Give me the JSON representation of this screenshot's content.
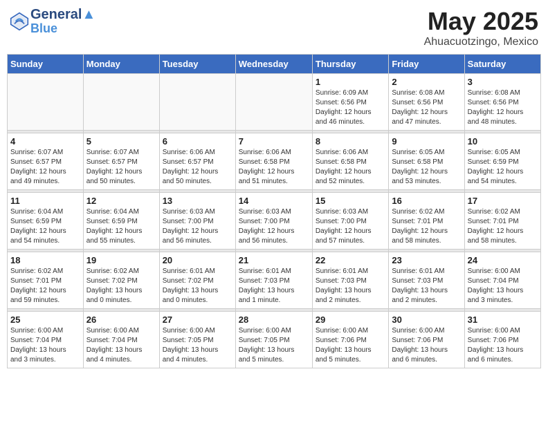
{
  "header": {
    "logo_line1": "General",
    "logo_line2": "Blue",
    "month": "May 2025",
    "location": "Ahuacuotzingo, Mexico"
  },
  "weekdays": [
    "Sunday",
    "Monday",
    "Tuesday",
    "Wednesday",
    "Thursday",
    "Friday",
    "Saturday"
  ],
  "weeks": [
    [
      {
        "day": "",
        "info": ""
      },
      {
        "day": "",
        "info": ""
      },
      {
        "day": "",
        "info": ""
      },
      {
        "day": "",
        "info": ""
      },
      {
        "day": "1",
        "info": "Sunrise: 6:09 AM\nSunset: 6:56 PM\nDaylight: 12 hours\nand 46 minutes."
      },
      {
        "day": "2",
        "info": "Sunrise: 6:08 AM\nSunset: 6:56 PM\nDaylight: 12 hours\nand 47 minutes."
      },
      {
        "day": "3",
        "info": "Sunrise: 6:08 AM\nSunset: 6:56 PM\nDaylight: 12 hours\nand 48 minutes."
      }
    ],
    [
      {
        "day": "4",
        "info": "Sunrise: 6:07 AM\nSunset: 6:57 PM\nDaylight: 12 hours\nand 49 minutes."
      },
      {
        "day": "5",
        "info": "Sunrise: 6:07 AM\nSunset: 6:57 PM\nDaylight: 12 hours\nand 50 minutes."
      },
      {
        "day": "6",
        "info": "Sunrise: 6:06 AM\nSunset: 6:57 PM\nDaylight: 12 hours\nand 50 minutes."
      },
      {
        "day": "7",
        "info": "Sunrise: 6:06 AM\nSunset: 6:58 PM\nDaylight: 12 hours\nand 51 minutes."
      },
      {
        "day": "8",
        "info": "Sunrise: 6:06 AM\nSunset: 6:58 PM\nDaylight: 12 hours\nand 52 minutes."
      },
      {
        "day": "9",
        "info": "Sunrise: 6:05 AM\nSunset: 6:58 PM\nDaylight: 12 hours\nand 53 minutes."
      },
      {
        "day": "10",
        "info": "Sunrise: 6:05 AM\nSunset: 6:59 PM\nDaylight: 12 hours\nand 54 minutes."
      }
    ],
    [
      {
        "day": "11",
        "info": "Sunrise: 6:04 AM\nSunset: 6:59 PM\nDaylight: 12 hours\nand 54 minutes."
      },
      {
        "day": "12",
        "info": "Sunrise: 6:04 AM\nSunset: 6:59 PM\nDaylight: 12 hours\nand 55 minutes."
      },
      {
        "day": "13",
        "info": "Sunrise: 6:03 AM\nSunset: 7:00 PM\nDaylight: 12 hours\nand 56 minutes."
      },
      {
        "day": "14",
        "info": "Sunrise: 6:03 AM\nSunset: 7:00 PM\nDaylight: 12 hours\nand 56 minutes."
      },
      {
        "day": "15",
        "info": "Sunrise: 6:03 AM\nSunset: 7:00 PM\nDaylight: 12 hours\nand 57 minutes."
      },
      {
        "day": "16",
        "info": "Sunrise: 6:02 AM\nSunset: 7:01 PM\nDaylight: 12 hours\nand 58 minutes."
      },
      {
        "day": "17",
        "info": "Sunrise: 6:02 AM\nSunset: 7:01 PM\nDaylight: 12 hours\nand 58 minutes."
      }
    ],
    [
      {
        "day": "18",
        "info": "Sunrise: 6:02 AM\nSunset: 7:01 PM\nDaylight: 12 hours\nand 59 minutes."
      },
      {
        "day": "19",
        "info": "Sunrise: 6:02 AM\nSunset: 7:02 PM\nDaylight: 13 hours\nand 0 minutes."
      },
      {
        "day": "20",
        "info": "Sunrise: 6:01 AM\nSunset: 7:02 PM\nDaylight: 13 hours\nand 0 minutes."
      },
      {
        "day": "21",
        "info": "Sunrise: 6:01 AM\nSunset: 7:03 PM\nDaylight: 13 hours\nand 1 minute."
      },
      {
        "day": "22",
        "info": "Sunrise: 6:01 AM\nSunset: 7:03 PM\nDaylight: 13 hours\nand 2 minutes."
      },
      {
        "day": "23",
        "info": "Sunrise: 6:01 AM\nSunset: 7:03 PM\nDaylight: 13 hours\nand 2 minutes."
      },
      {
        "day": "24",
        "info": "Sunrise: 6:00 AM\nSunset: 7:04 PM\nDaylight: 13 hours\nand 3 minutes."
      }
    ],
    [
      {
        "day": "25",
        "info": "Sunrise: 6:00 AM\nSunset: 7:04 PM\nDaylight: 13 hours\nand 3 minutes."
      },
      {
        "day": "26",
        "info": "Sunrise: 6:00 AM\nSunset: 7:04 PM\nDaylight: 13 hours\nand 4 minutes."
      },
      {
        "day": "27",
        "info": "Sunrise: 6:00 AM\nSunset: 7:05 PM\nDaylight: 13 hours\nand 4 minutes."
      },
      {
        "day": "28",
        "info": "Sunrise: 6:00 AM\nSunset: 7:05 PM\nDaylight: 13 hours\nand 5 minutes."
      },
      {
        "day": "29",
        "info": "Sunrise: 6:00 AM\nSunset: 7:06 PM\nDaylight: 13 hours\nand 5 minutes."
      },
      {
        "day": "30",
        "info": "Sunrise: 6:00 AM\nSunset: 7:06 PM\nDaylight: 13 hours\nand 6 minutes."
      },
      {
        "day": "31",
        "info": "Sunrise: 6:00 AM\nSunset: 7:06 PM\nDaylight: 13 hours\nand 6 minutes."
      }
    ]
  ]
}
